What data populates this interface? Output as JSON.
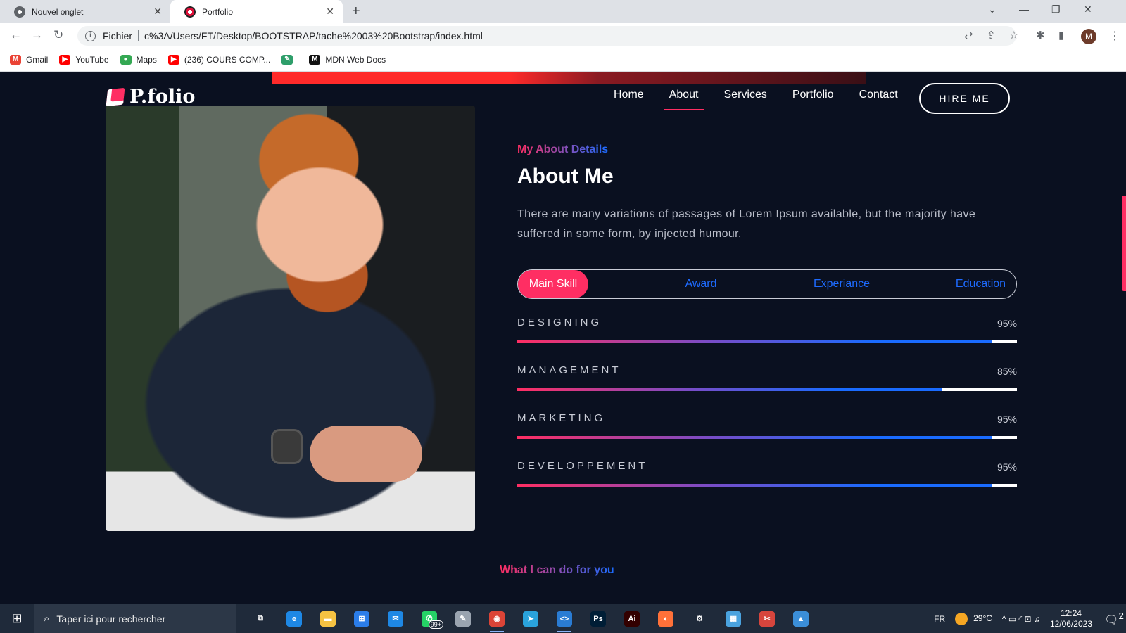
{
  "browser": {
    "tabs": [
      {
        "title": "Nouvel onglet",
        "active": false
      },
      {
        "title": "Portfolio",
        "active": true
      }
    ],
    "new_tab": "+",
    "window_controls": {
      "list": "⌄",
      "minimize": "—",
      "restore": "❐",
      "close": "✕"
    },
    "address": {
      "scheme_label": "Fichier",
      "url": "c%3A/Users/FT/Desktop/BOOTSTRAP/tache%2003%20Bootstrap/index.html",
      "info_glyph": "i"
    },
    "nav": {
      "back": "←",
      "forward": "→",
      "reload": "↻"
    },
    "toolbar": {
      "translate": "⇄",
      "share": "⇪",
      "star": "☆",
      "extensions": "✱",
      "sidepanel": "▮",
      "profile_initial": "M",
      "menu": "⋮"
    },
    "bookmarks": [
      {
        "label": "Gmail",
        "icon": "gmail-icon",
        "color": "#ea4335",
        "glyph": "M"
      },
      {
        "label": "YouTube",
        "icon": "youtube-icon",
        "color": "#ff0000",
        "glyph": "▶"
      },
      {
        "label": "Maps",
        "icon": "maps-icon",
        "color": "#34a853",
        "glyph": "●"
      },
      {
        "label": "(236) COURS COMP...",
        "icon": "youtube-icon",
        "color": "#ff0000",
        "glyph": "▶"
      },
      {
        "label": "",
        "icon": "bookmark-icon",
        "color": "#2e9e6a",
        "glyph": "✎"
      },
      {
        "label": "MDN Web Docs",
        "icon": "mdn-icon",
        "color": "#111111",
        "glyph": "M"
      }
    ]
  },
  "site": {
    "logo": "P.folio",
    "nav": [
      {
        "label": "Home",
        "active": false
      },
      {
        "label": "About",
        "active": true
      },
      {
        "label": "Services",
        "active": false
      },
      {
        "label": "Portfolio",
        "active": false
      },
      {
        "label": "Contact",
        "active": false
      }
    ],
    "hire_button": "HIRE ME",
    "about": {
      "subtitle": "My About Details",
      "heading": "About Me",
      "description": "There are many variations of passages of Lorem Ipsum available, but the majority have suffered in some form, by injected humour.",
      "tabs": [
        "Main Skill",
        "Award",
        "Experiance",
        "Education"
      ],
      "active_tab": "Main Skill",
      "skills": [
        {
          "name": "DESIGNING",
          "percent": 95,
          "label": "95%"
        },
        {
          "name": "MANAGEMENT",
          "percent": 85,
          "label": "85%"
        },
        {
          "name": "MARKETING",
          "percent": 95,
          "label": "95%"
        },
        {
          "name": "DEVELOPPEMENT",
          "percent": 95,
          "label": "95%"
        }
      ]
    },
    "next_section_subtitle": "What I can do for you"
  },
  "taskbar": {
    "search_placeholder": "Taper ici pour rechercher",
    "apps": [
      {
        "name": "task-view-icon",
        "glyph": "⧉",
        "color": "transparent",
        "running": false
      },
      {
        "name": "edge-icon",
        "glyph": "e",
        "color": "#1e88e5",
        "running": false
      },
      {
        "name": "file-explorer-icon",
        "glyph": "▬",
        "color": "#f5c242",
        "running": false
      },
      {
        "name": "store-icon",
        "glyph": "⊞",
        "color": "#2b7de9",
        "running": false
      },
      {
        "name": "mail-icon",
        "glyph": "✉",
        "color": "#1e88e5",
        "running": false
      },
      {
        "name": "whatsapp-icon",
        "glyph": "✆",
        "color": "#25d366",
        "running": false,
        "badge": "99+"
      },
      {
        "name": "paint-icon",
        "glyph": "✎",
        "color": "#9aa4b0",
        "running": false
      },
      {
        "name": "chrome-icon",
        "glyph": "◉",
        "color": "#db4437",
        "running": true
      },
      {
        "name": "telegram-icon",
        "glyph": "➤",
        "color": "#2aa3dc",
        "running": false
      },
      {
        "name": "vscode-icon",
        "glyph": "<>",
        "color": "#2a7cd3",
        "running": true
      },
      {
        "name": "photoshop-icon",
        "glyph": "Ps",
        "color": "#001e36",
        "running": false
      },
      {
        "name": "illustrator-icon",
        "glyph": "Ai",
        "color": "#330000",
        "running": false
      },
      {
        "name": "firefox-icon",
        "glyph": "◐",
        "color": "#ff7139",
        "running": false
      },
      {
        "name": "settings-icon",
        "glyph": "⚙",
        "color": "transparent",
        "running": false
      },
      {
        "name": "control-panel-icon",
        "glyph": "▦",
        "color": "#4aa3df",
        "running": false
      },
      {
        "name": "snipping-tool-icon",
        "glyph": "✂",
        "color": "#d6453d",
        "running": false
      },
      {
        "name": "photos-icon",
        "glyph": "▲",
        "color": "#3b8ed8",
        "running": false
      }
    ],
    "language": "FR",
    "temperature": "29°C",
    "tray_icons": "^  ▭  ◜  ⊡  ♫",
    "time": "12:24",
    "date": "12/06/2023",
    "notification_count": "2"
  }
}
